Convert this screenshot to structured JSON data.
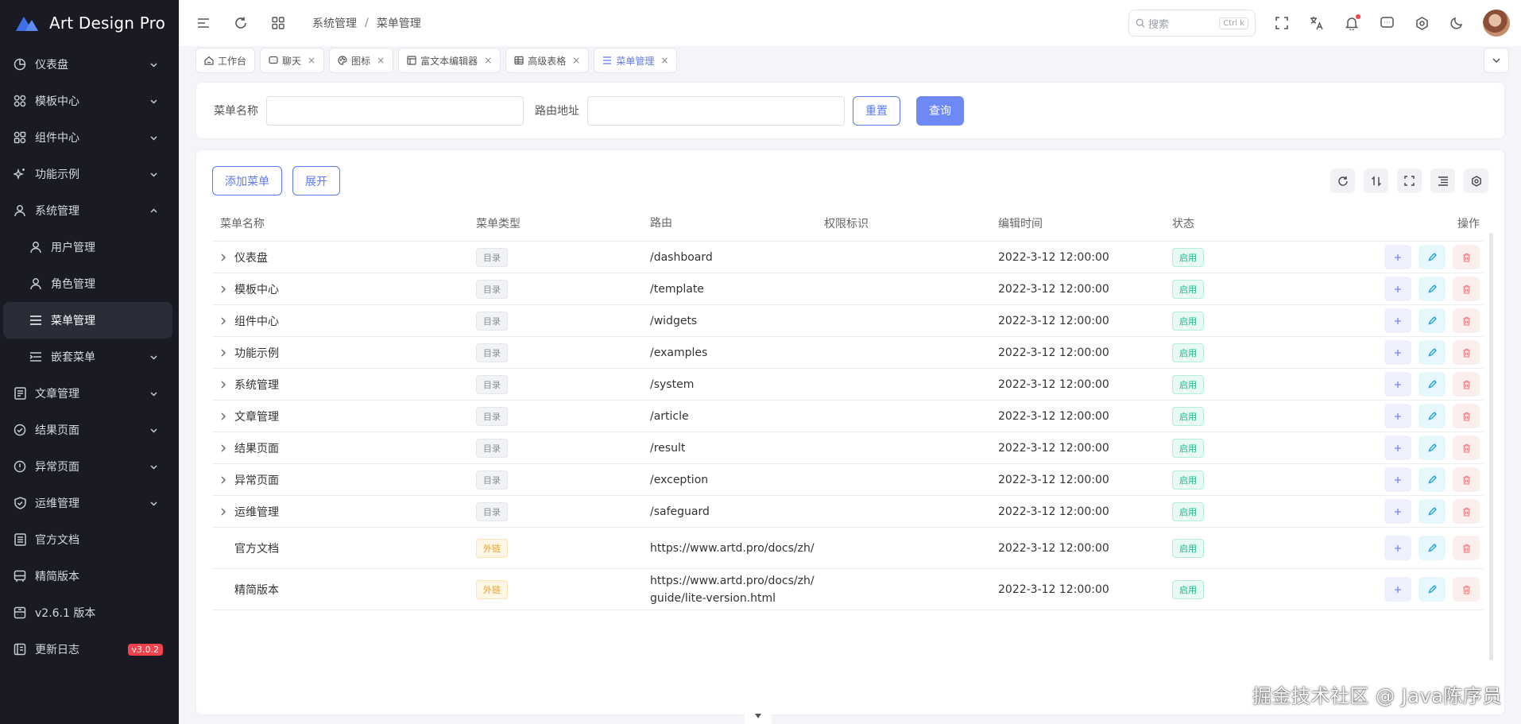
{
  "app": {
    "title": "Art Design Pro",
    "accent": "#5d79f0"
  },
  "sidebar": {
    "items": [
      {
        "label": "仪表盘",
        "icon": "dashboard-icon",
        "expandable": true
      },
      {
        "label": "模板中心",
        "icon": "grid-icon",
        "expandable": true
      },
      {
        "label": "组件中心",
        "icon": "widgets-icon",
        "expandable": true
      },
      {
        "label": "功能示例",
        "icon": "sparkle-icon",
        "expandable": true
      },
      {
        "label": "系统管理",
        "icon": "user-icon",
        "expandable": true,
        "open": true
      },
      {
        "label": "用户管理",
        "icon": "user-icon",
        "sub": true
      },
      {
        "label": "角色管理",
        "icon": "user-icon",
        "sub": true
      },
      {
        "label": "菜单管理",
        "icon": "menu-icon",
        "sub": true,
        "active": true
      },
      {
        "label": "嵌套菜单",
        "icon": "nested-icon",
        "sub": true,
        "expandable": true
      },
      {
        "label": "文章管理",
        "icon": "article-icon",
        "expandable": true
      },
      {
        "label": "结果页面",
        "icon": "check-circle-icon",
        "expandable": true
      },
      {
        "label": "异常页面",
        "icon": "alert-icon",
        "expandable": true
      },
      {
        "label": "运维管理",
        "icon": "shield-icon",
        "expandable": true
      },
      {
        "label": "官方文档",
        "icon": "doc-icon"
      },
      {
        "label": "精简版本",
        "icon": "bus-icon"
      },
      {
        "label": "v2.6.1 版本",
        "icon": "version-icon"
      },
      {
        "label": "更新日志",
        "icon": "log-icon",
        "badge": "v3.0.2"
      }
    ]
  },
  "header": {
    "breadcrumb": [
      "系统管理",
      "菜单管理"
    ],
    "search_placeholder": "搜索",
    "search_shortcut": "Ctrl k"
  },
  "tabs": [
    {
      "label": "工作台",
      "icon": "home-icon",
      "closable": false
    },
    {
      "label": "聊天",
      "icon": "chat-icon",
      "closable": true
    },
    {
      "label": "图标",
      "icon": "palette-icon",
      "closable": true
    },
    {
      "label": "富文本编辑器",
      "icon": "editor-icon",
      "closable": true
    },
    {
      "label": "高级表格",
      "icon": "table-icon",
      "closable": true
    },
    {
      "label": "菜单管理",
      "icon": "menu-icon",
      "closable": true,
      "active": true
    }
  ],
  "filters": {
    "name_label": "菜单名称",
    "name_value": "",
    "route_label": "路由地址",
    "route_value": "",
    "reset_label": "重置",
    "query_label": "查询"
  },
  "toolbar": {
    "add_label": "添加菜单",
    "expand_label": "展开"
  },
  "table": {
    "columns": [
      "菜单名称",
      "菜单类型",
      "路由",
      "权限标识",
      "编辑时间",
      "状态",
      "操作"
    ],
    "rows": [
      {
        "name": "仪表盘",
        "type": "目录",
        "kind": "dir",
        "path": "/dashboard",
        "perm": "",
        "time": "2022-3-12 12:00:00",
        "status": "启用",
        "expandable": true
      },
      {
        "name": "模板中心",
        "type": "目录",
        "kind": "dir",
        "path": "/template",
        "perm": "",
        "time": "2022-3-12 12:00:00",
        "status": "启用",
        "expandable": true
      },
      {
        "name": "组件中心",
        "type": "目录",
        "kind": "dir",
        "path": "/widgets",
        "perm": "",
        "time": "2022-3-12 12:00:00",
        "status": "启用",
        "expandable": true
      },
      {
        "name": "功能示例",
        "type": "目录",
        "kind": "dir",
        "path": "/examples",
        "perm": "",
        "time": "2022-3-12 12:00:00",
        "status": "启用",
        "expandable": true
      },
      {
        "name": "系统管理",
        "type": "目录",
        "kind": "dir",
        "path": "/system",
        "perm": "",
        "time": "2022-3-12 12:00:00",
        "status": "启用",
        "expandable": true
      },
      {
        "name": "文章管理",
        "type": "目录",
        "kind": "dir",
        "path": "/article",
        "perm": "",
        "time": "2022-3-12 12:00:00",
        "status": "启用",
        "expandable": true
      },
      {
        "name": "结果页面",
        "type": "目录",
        "kind": "dir",
        "path": "/result",
        "perm": "",
        "time": "2022-3-12 12:00:00",
        "status": "启用",
        "expandable": true
      },
      {
        "name": "异常页面",
        "type": "目录",
        "kind": "dir",
        "path": "/exception",
        "perm": "",
        "time": "2022-3-12 12:00:00",
        "status": "启用",
        "expandable": true
      },
      {
        "name": "运维管理",
        "type": "目录",
        "kind": "dir",
        "path": "/safeguard",
        "perm": "",
        "time": "2022-3-12 12:00:00",
        "status": "启用",
        "expandable": true
      },
      {
        "name": "官方文档",
        "type": "外链",
        "kind": "link",
        "path": "https://www.artd.pro/docs/zh/",
        "perm": "",
        "time": "2022-3-12 12:00:00",
        "status": "启用",
        "expandable": false
      },
      {
        "name": "精简版本",
        "type": "外链",
        "kind": "link",
        "path": "https://www.artd.pro/docs/zh/guide/lite-version.html",
        "perm": "",
        "time": "2022-3-12 12:00:00",
        "status": "启用",
        "expandable": false
      }
    ]
  },
  "watermark": "掘金技术社区 @ Java陈序员"
}
